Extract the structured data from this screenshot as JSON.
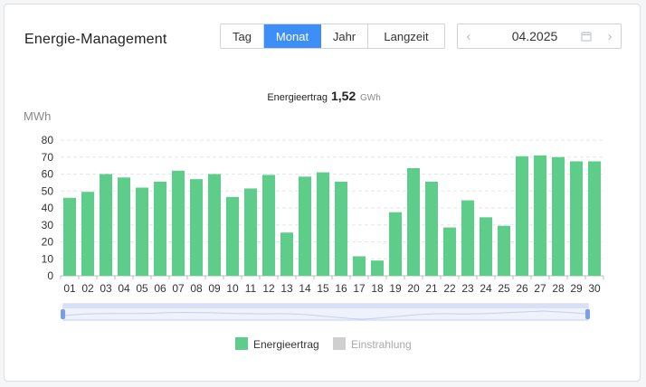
{
  "header": {
    "title": "Energie-Management",
    "tabs": [
      "Tag",
      "Monat",
      "Jahr",
      "Langzeit"
    ],
    "active_tab": "Monat",
    "date_value": "04.2025"
  },
  "summary": {
    "label": "Energieertrag",
    "value": "1,52",
    "unit": "GWh"
  },
  "colors": {
    "accent": "#3d8ef7",
    "bar": "#5ecd8a",
    "inactive_legend": "#cfcfcf",
    "grid": "#e3e6ea"
  },
  "chart_data": {
    "type": "bar",
    "ylabel": "MWh",
    "ylim": [
      0,
      80
    ],
    "yticks": [
      0,
      10,
      20,
      30,
      40,
      50,
      60,
      70,
      80
    ],
    "grid": true,
    "categories": [
      "01",
      "02",
      "03",
      "04",
      "05",
      "06",
      "07",
      "08",
      "09",
      "10",
      "11",
      "12",
      "13",
      "14",
      "15",
      "16",
      "17",
      "18",
      "19",
      "20",
      "21",
      "22",
      "23",
      "24",
      "25",
      "26",
      "27",
      "28",
      "29",
      "30"
    ],
    "series": [
      {
        "name": "Energieertrag",
        "visible": true,
        "values": [
          46,
          49.5,
          60,
          58,
          52,
          55.5,
          62,
          57,
          60,
          46.5,
          51.5,
          59.5,
          25.5,
          58.5,
          61,
          55.5,
          11.5,
          9,
          37.5,
          63.5,
          55.5,
          28.5,
          44.5,
          34.5,
          29.5,
          70.5,
          71,
          70,
          67.5,
          67.5
        ]
      },
      {
        "name": "Einstrahlung",
        "visible": false,
        "values": []
      }
    ],
    "legend_position": "bottom-center"
  }
}
